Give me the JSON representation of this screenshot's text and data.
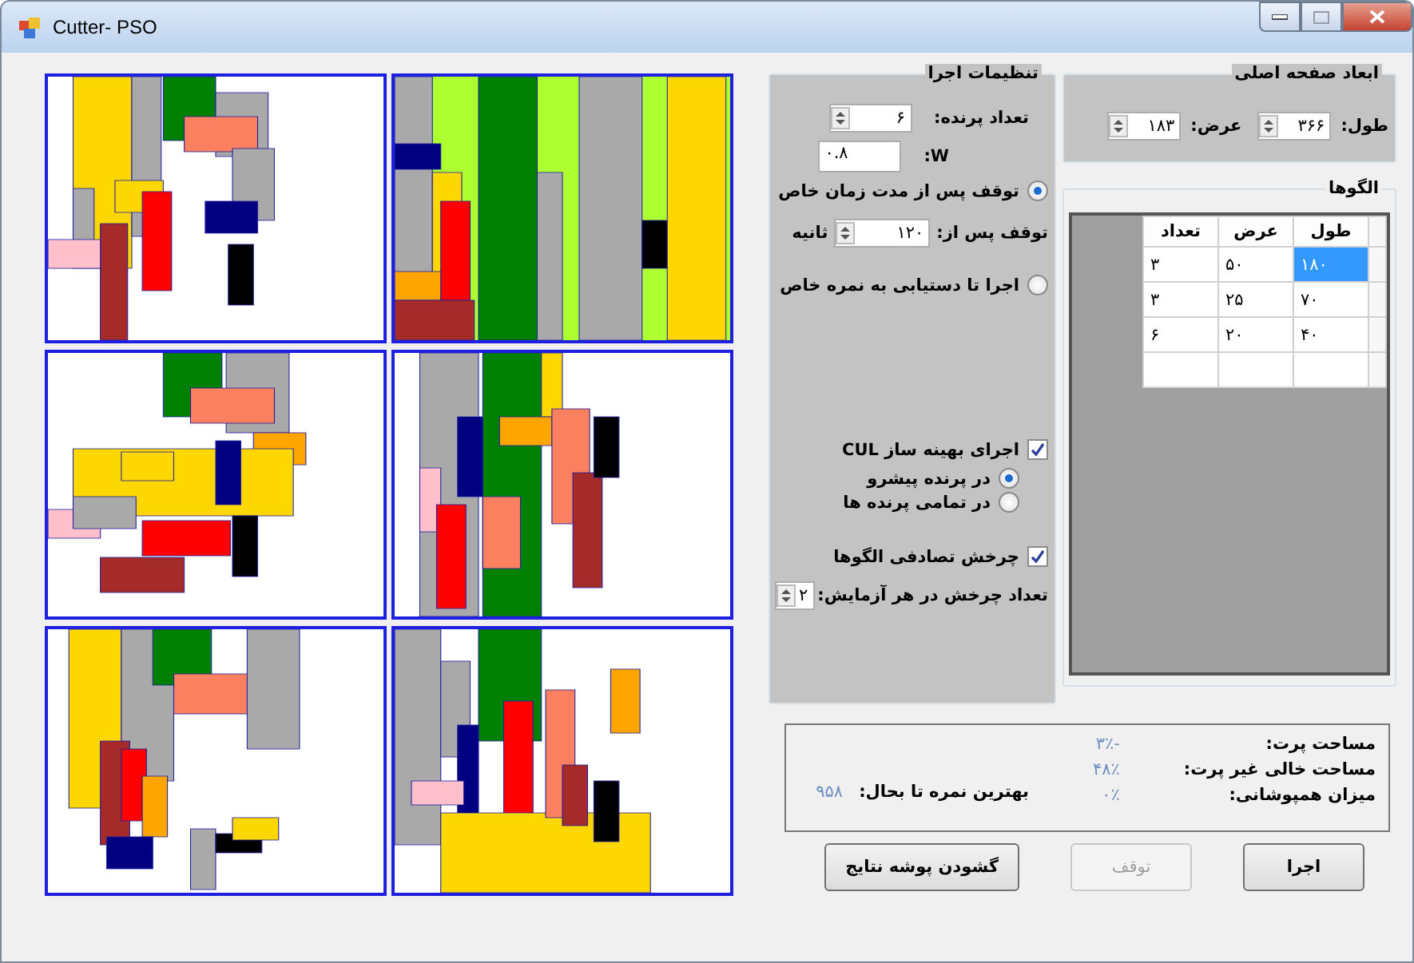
{
  "window": {
    "title": "Cutter- PSO"
  },
  "run_settings": {
    "title": "تنظیمات اجرا",
    "particles": {
      "label": "تعداد پرنده:",
      "value": "۶"
    },
    "w": {
      "label": "W:",
      "value": "۰.۸"
    },
    "stop_modes": [
      {
        "label": "توقف پس از مدت زمان خاص",
        "selected": true
      },
      {
        "label": "اجرا تا دستیابی به نمره خاص",
        "selected": false
      }
    ],
    "stop_after": {
      "label": "توقف پس از:",
      "value": "۱۲۰",
      "unit": "ثانیه"
    },
    "cul": {
      "label": "اجرای بهینه ساز CUL",
      "checked": true,
      "options": [
        {
          "label": "در پرنده پیشرو",
          "selected": true
        },
        {
          "label": "در تمامی پرنده ها",
          "selected": false
        }
      ]
    },
    "rotation": {
      "label": "چرخش تصادفی الگوها",
      "checked": true
    },
    "rotations": {
      "label": "تعداد چرخش در هر آزمایش:",
      "value": "۲"
    }
  },
  "sheet": {
    "title": "ابعاد صفحه اصلی",
    "length": {
      "label": "طول:",
      "value": "۳۶۶"
    },
    "width": {
      "label": "عرض:",
      "value": "۱۸۳"
    }
  },
  "patterns": {
    "title": "الگوها",
    "columns": [
      "طول",
      "عرض",
      "تعداد"
    ],
    "rows": [
      {
        "cells": [
          {
            "text": "۱۸۰",
            "selected": true
          },
          {
            "text": "۵۰",
            "selected": false
          },
          {
            "text": "۳",
            "selected": false
          }
        ]
      },
      {
        "cells": [
          {
            "text": "۷۰",
            "selected": false
          },
          {
            "text": "۲۵",
            "selected": false
          },
          {
            "text": "۳",
            "selected": false
          }
        ]
      },
      {
        "cells": [
          {
            "text": "۴۰",
            "selected": false
          },
          {
            "text": "۲۰",
            "selected": false
          },
          {
            "text": "۶",
            "selected": false
          }
        ]
      }
    ]
  },
  "results": {
    "stats": [
      {
        "label": "مساحت پرت:",
        "value": "۳٪-"
      },
      {
        "label": "مساحت خالی غیر پرت:",
        "value": "۴۸٪"
      },
      {
        "label": "میزان همپوشانی:",
        "value": "۰٪"
      }
    ],
    "best": {
      "label": "بهترین نمره تا بحال:",
      "value": "۹۵۸"
    }
  },
  "buttons": [
    {
      "label": "اجرا",
      "disabled": false
    },
    {
      "label": "توقف",
      "disabled": true
    },
    {
      "label": "گشودن پوشه نتایج",
      "disabled": false
    }
  ]
}
